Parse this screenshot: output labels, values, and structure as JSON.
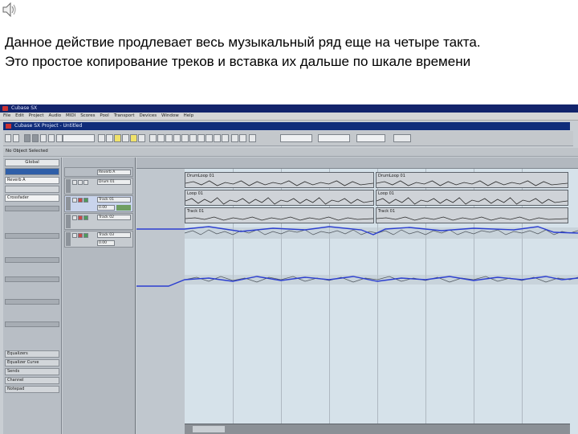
{
  "caption": {
    "line1": "Данное действие продлевает весь музыкальный ряд еще на четыре такта.",
    "line2": "Это простое копирование треков и вставка их дальше по шкале времени"
  },
  "speaker_icon": "speaker-icon",
  "screenshot": {
    "app_title": "Cubase SX",
    "menu_items": [
      "File",
      "Edit",
      "Project",
      "Audio",
      "MIDI",
      "Scores",
      "Pool",
      "Transport",
      "Devices",
      "Window",
      "Help"
    ],
    "project_title": "Cubase SX Project - Untitled",
    "status_text": "No Object Selected",
    "inspector": {
      "header": "Global",
      "rows": [
        "Reverb A",
        "Crossfader"
      ],
      "sections": [
        "Equalizers",
        "Equalizer Curve",
        "Sends",
        "Channel",
        "Notepad"
      ]
    },
    "tracks": [
      {
        "name": "Reverb A",
        "value": ""
      },
      {
        "name": "Drum 01",
        "value": ""
      },
      {
        "name": "Track 01",
        "value": "0.00"
      },
      {
        "name": "Track 02",
        "value": ""
      },
      {
        "name": "Track 03",
        "value": "0.00"
      }
    ],
    "parts": [
      {
        "label": "DrumLoop 01",
        "lane": 0
      },
      {
        "label": "DrumLoop 01",
        "lane": 0
      },
      {
        "label": "Loop 01",
        "lane": 1
      },
      {
        "label": "Loop 01",
        "lane": 1
      },
      {
        "label": "Track 01",
        "lane": 2
      },
      {
        "label": "Track 01",
        "lane": 2
      }
    ],
    "colors": {
      "title_bar": "#13246b",
      "automation_line": "#2c3fd0",
      "selection": "#d6e2ea"
    }
  }
}
